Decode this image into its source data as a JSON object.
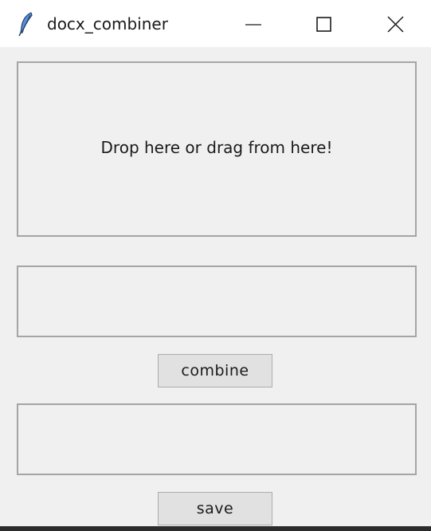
{
  "window": {
    "title": "docx_combiner",
    "icon": "feather-icon",
    "controls": {
      "minimize_icon": "minimize-icon",
      "maximize_icon": "maximize-icon",
      "close_icon": "close-icon"
    }
  },
  "main": {
    "drop_zone_label": "Drop here or drag from here!",
    "combine_label": "combine",
    "save_label": "save"
  },
  "colors": {
    "background": "#f0f0f0",
    "titlebar": "#ffffff",
    "border": "#a5a5a5",
    "button_face": "#e1e1e1"
  }
}
